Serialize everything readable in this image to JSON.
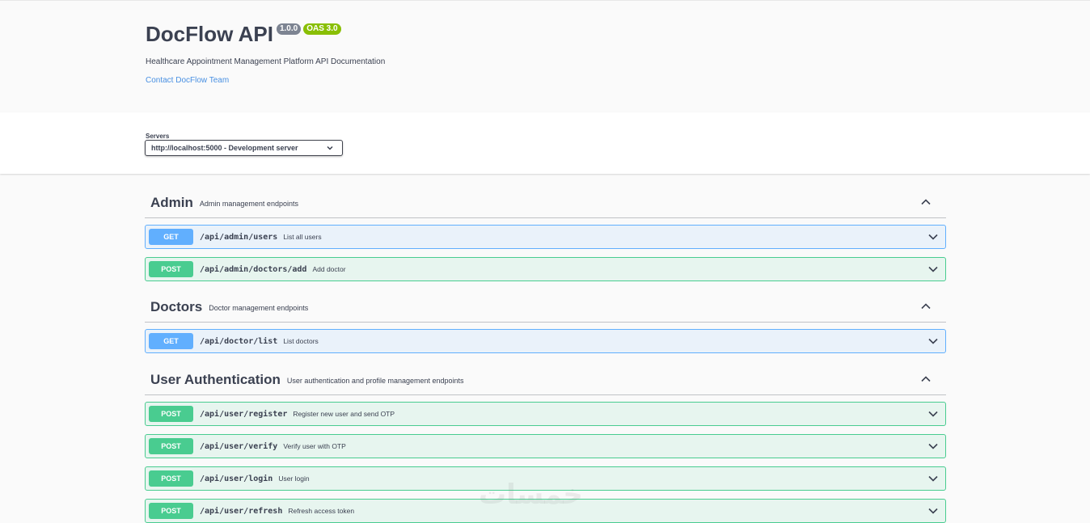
{
  "info": {
    "title": "DocFlow API",
    "version": "1.0.0",
    "oas": "OAS 3.0",
    "description": "Healthcare Appointment Management Platform API Documentation",
    "contact": "Contact DocFlow Team"
  },
  "servers": {
    "label": "Servers",
    "selected": "http://localhost:5000 - Development server"
  },
  "tags": [
    {
      "name": "Admin",
      "description": "Admin management endpoints",
      "operations": [
        {
          "method": "GET",
          "path": "/api/admin/users",
          "summary": "List all users"
        },
        {
          "method": "POST",
          "path": "/api/admin/doctors/add",
          "summary": "Add doctor"
        }
      ]
    },
    {
      "name": "Doctors",
      "description": "Doctor management endpoints",
      "operations": [
        {
          "method": "GET",
          "path": "/api/doctor/list",
          "summary": "List doctors"
        }
      ]
    },
    {
      "name": "User Authentication",
      "description": "User authentication and profile management endpoints",
      "operations": [
        {
          "method": "POST",
          "path": "/api/user/register",
          "summary": "Register new user and send OTP"
        },
        {
          "method": "POST",
          "path": "/api/user/verify",
          "summary": "Verify user with OTP"
        },
        {
          "method": "POST",
          "path": "/api/user/login",
          "summary": "User login"
        },
        {
          "method": "POST",
          "path": "/api/user/refresh",
          "summary": "Refresh access token"
        }
      ]
    }
  ],
  "watermark": "خمسات",
  "colors": {
    "get": "#61affe",
    "post": "#49cc90",
    "link": "#4990e2",
    "version_badge": "#7d8492",
    "oas_badge": "#89bf04"
  },
  "icons": {
    "tag_toggle": "chevron-up-icon",
    "operation_toggle": "chevron-down-icon",
    "select_arrow": "chevron-down-icon"
  }
}
